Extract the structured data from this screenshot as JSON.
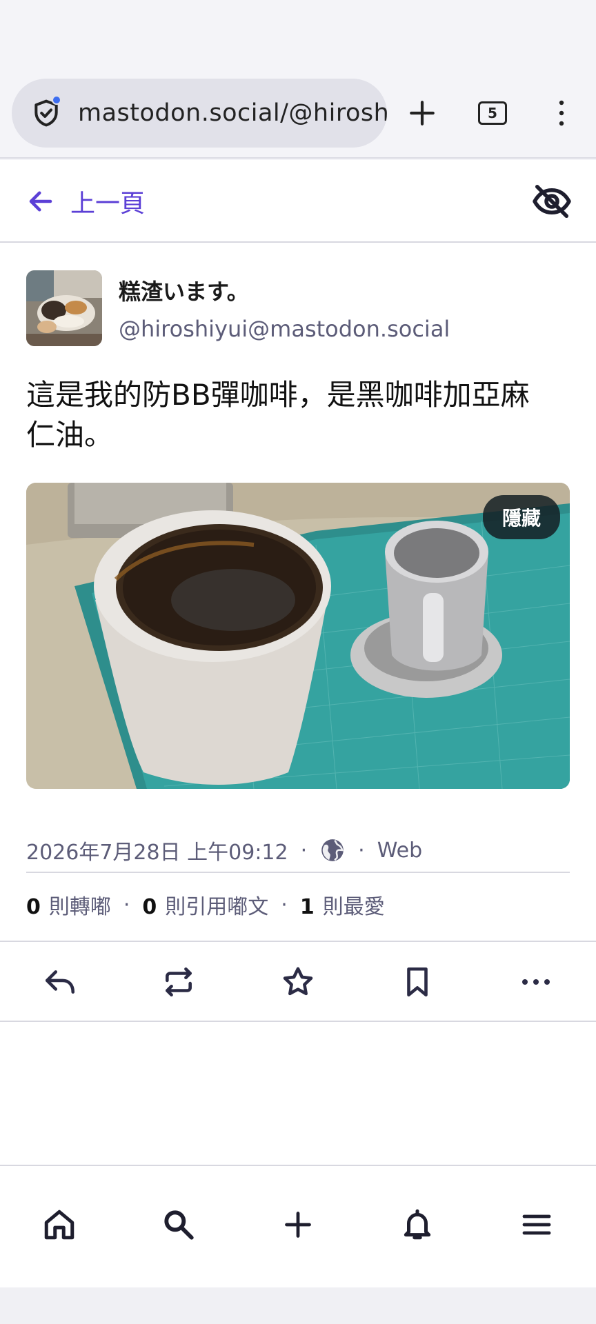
{
  "browser": {
    "url": "mastodon.social/@hiroshiyui",
    "tab_count": "5"
  },
  "app": {
    "back_label": "上一頁"
  },
  "post": {
    "display_name": "糕渣います。",
    "handle": "@hiroshiyui@mastodon.social",
    "text_line1": "這是我的防BB彈咖啡，是黑咖啡加亞麻",
    "text_line2": "仁油。",
    "media_hide_label": "隱藏",
    "timestamp": "2026年7月28日 上午09:12",
    "visibility_icon": "globe-icon",
    "client": "Web",
    "boosts_count": "0",
    "boosts_label": "則轉嘟",
    "quotes_count": "0",
    "quotes_label": "則引用嘟文",
    "favourites_count": "1",
    "favourites_label": "則最愛",
    "separator": "·"
  },
  "colors": {
    "accent": "#5b3fd6",
    "muted": "#5c5c78",
    "icon": "#2b2b45"
  }
}
